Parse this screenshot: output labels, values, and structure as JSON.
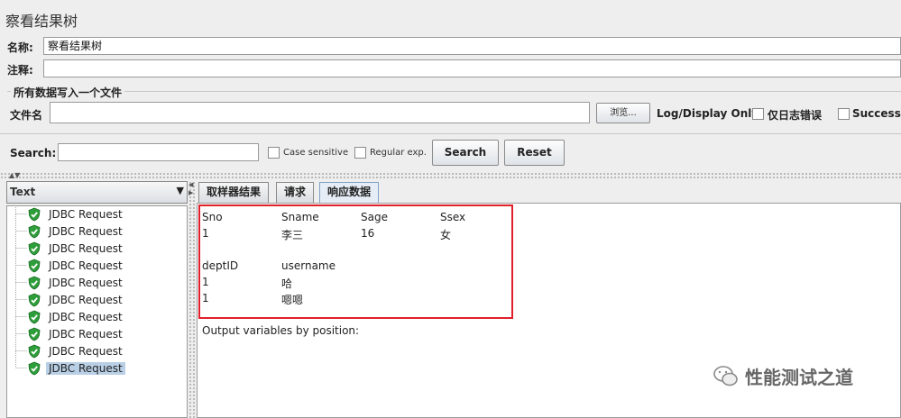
{
  "window": {
    "title": "察看结果树"
  },
  "form": {
    "name_label": "名称:",
    "name_value": "察看结果树",
    "comment_label": "注释:",
    "comment_value": ""
  },
  "file_group": {
    "legend": "所有数据写入一个文件",
    "filename_label": "文件名",
    "filename_value": "",
    "browse_label": "浏览...",
    "log_display_label": "Log/Display Only:",
    "errors_label": "仅日志错误",
    "successes_label": "Successes"
  },
  "search": {
    "label": "Search:",
    "value": "",
    "case_sensitive_label": "Case sensitive",
    "regex_label": "Regular exp.",
    "search_button": "Search",
    "reset_button": "Reset"
  },
  "renderer": {
    "selected": "Text"
  },
  "tree": {
    "items": [
      {
        "label": "JDBC Request"
      },
      {
        "label": "JDBC Request"
      },
      {
        "label": "JDBC Request"
      },
      {
        "label": "JDBC Request"
      },
      {
        "label": "JDBC Request"
      },
      {
        "label": "JDBC Request"
      },
      {
        "label": "JDBC Request"
      },
      {
        "label": "JDBC Request"
      },
      {
        "label": "JDBC Request"
      },
      {
        "label": "JDBC Request"
      }
    ]
  },
  "tabs": [
    {
      "label": "取样器结果"
    },
    {
      "label": "请求"
    },
    {
      "label": "响应数据"
    }
  ],
  "response": {
    "table1": {
      "headers": [
        "Sno",
        "Sname",
        "Sage",
        "Ssex"
      ],
      "rows": [
        [
          "1",
          "李三",
          "16",
          "女"
        ]
      ]
    },
    "table2": {
      "headers": [
        "deptID",
        "username"
      ],
      "rows": [
        [
          "1",
          "哈"
        ],
        [
          "1",
          "嗯嗯"
        ]
      ]
    },
    "footer_text": "Output variables by position:"
  },
  "watermark": {
    "text": "性能测试之道"
  },
  "colors": {
    "highlight_border": "#e0202a",
    "selected_bg": "#b8cfe5",
    "shield_green": "#2e9e3a"
  }
}
